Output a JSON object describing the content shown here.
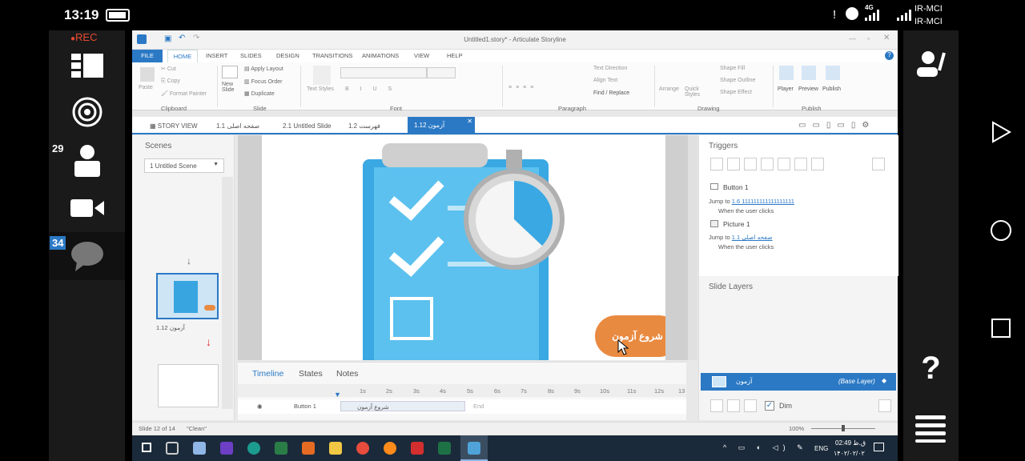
{
  "phone": {
    "time": "13:19",
    "network": "4G",
    "carrier1": "IR-MCI",
    "carrier2": "IR-MCI"
  },
  "meeting": {
    "rec_label": "REC",
    "participants_count": "29",
    "chat_count": "34"
  },
  "app": {
    "window_title": "Untitled1.story* - Articulate Storyline",
    "tabs": [
      "FILE",
      "HOME",
      "INSERT",
      "SLIDES",
      "DESIGN",
      "TRANSITIONS",
      "ANIMATIONS",
      "VIEW",
      "HELP"
    ],
    "ribbon": {
      "paste": "Paste",
      "cut": "Cut",
      "copy": "Copy",
      "format_painter": "Format Painter",
      "clipboard": "Clipboard",
      "new_slide": "New Slide",
      "apply_layout": "Apply Layout",
      "focus_order": "Focus Order",
      "duplicate": "Duplicate",
      "slide": "Slide",
      "text_styles": "Text Styles",
      "font": "Font",
      "text_direction": "Text Direction",
      "align_text": "Align Text",
      "find_replace": "Find / Replace",
      "paragraph": "Paragraph",
      "arrange": "Arrange",
      "quick_styles": "Quick Styles",
      "shape_fill": "Shape Fill",
      "shape_outline": "Shape Outline",
      "shape_effect": "Shape Effect",
      "drawing": "Drawing",
      "player": "Player",
      "preview": "Preview",
      "publish_btn": "Publish",
      "publish": "Publish"
    },
    "slide_tabs": {
      "story_view": "STORY VIEW",
      "t1": "1.1 صفحه اصلی",
      "t2": "2.1 Untitled Slide",
      "t3": "1.2 فهرست",
      "t4": "1.12 آزمون"
    },
    "scenes": {
      "title": "Scenes",
      "selected": "1 Untitled Scene",
      "thumb_label": "1.12 آزمون"
    },
    "slide": {
      "start_button": "شروع آزمون"
    },
    "timeline": {
      "tabs": [
        "Timeline",
        "States",
        "Notes"
      ],
      "ticks": [
        "1s",
        "2s",
        "3s",
        "4s",
        "5s",
        "6s",
        "7s",
        "8s",
        "9s",
        "10s",
        "11s",
        "12s",
        "13"
      ],
      "row_label": "Button 1",
      "row_text": "شروع آزمون",
      "end_label": "End"
    },
    "triggers": {
      "title": "Triggers",
      "items": [
        {
          "name": "Button 1",
          "action": "Jump to",
          "target": "1.6 111111111111111111",
          "when": "When the user clicks"
        },
        {
          "name": "Picture 1",
          "action": "Jump to",
          "target": "1.1 صفحه اصلی",
          "when": "When the user clicks"
        }
      ]
    },
    "layers": {
      "title": "Slide Layers",
      "base_name": "آزمون",
      "base_label": "(Base Layer)",
      "dim": "Dim"
    },
    "status": {
      "slide_info": "Slide 12 of 14",
      "theme": "\"Clean\"",
      "zoom": "100%"
    },
    "tray": {
      "lang": "ENG",
      "time": "02:49 ق.ظ",
      "date": "۱۴۰۲/۰۲/۰۲"
    }
  },
  "colors": {
    "accent": "#2b79c5",
    "orange": "#e98a41",
    "rec": "#e8492f"
  }
}
